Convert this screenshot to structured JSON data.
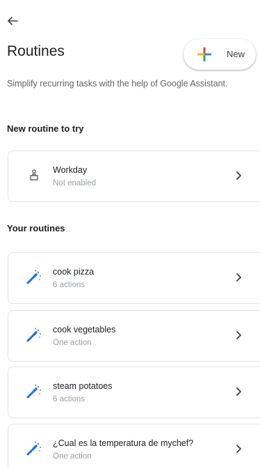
{
  "header": {
    "title": "Routines",
    "new_button_label": "New",
    "subtitle": "Simplify recurring tasks with the help of Google Assistant."
  },
  "suggested": {
    "section_title": "New routine to try",
    "item": {
      "name": "Workday",
      "status": "Not enabled",
      "icon": "workday-routine-icon"
    }
  },
  "your_routines": {
    "section_title": "Your routines",
    "items": [
      {
        "name": "cook pizza",
        "detail": "6 actions",
        "icon": "magic-wand-icon"
      },
      {
        "name": "cook vegetables",
        "detail": "One action",
        "icon": "magic-wand-icon"
      },
      {
        "name": "steam potatoes",
        "detail": "6 actions",
        "icon": "magic-wand-icon"
      },
      {
        "name": "¿Cual es la temperatura de mychef?",
        "detail": "One action",
        "icon": "magic-wand-icon"
      }
    ]
  },
  "colors": {
    "google_blue": "#4285F4",
    "google_red": "#EA4335",
    "google_yellow": "#FBBC04",
    "google_green": "#34A853",
    "wand_blue": "#1A73E8"
  }
}
